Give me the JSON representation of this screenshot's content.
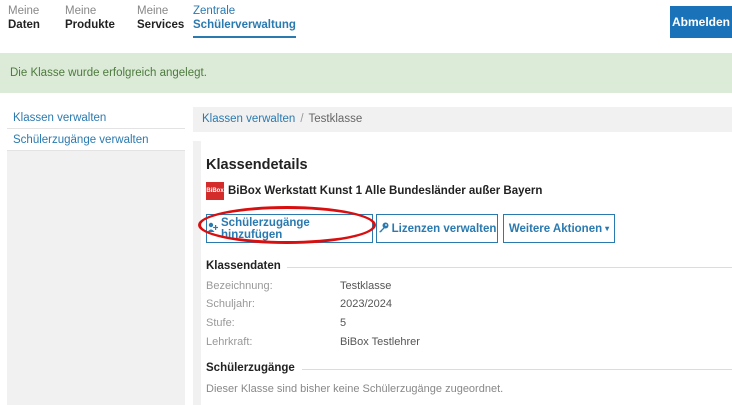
{
  "nav": {
    "items": [
      {
        "line1": "Meine",
        "line2": "Daten"
      },
      {
        "line1": "Meine",
        "line2": "Produkte"
      },
      {
        "line1": "Meine",
        "line2": "Services"
      },
      {
        "line1": "Zentrale",
        "line2": "Schülerverwaltung"
      }
    ],
    "logout_label": "Abmelden"
  },
  "alert": {
    "text": "Die Klasse wurde erfolgreich angelegt."
  },
  "sidebar": {
    "items": [
      {
        "label": "Klassen verwalten"
      },
      {
        "label": "Schülerzugänge verwalten"
      }
    ]
  },
  "breadcrumb": {
    "parent": "Klassen verwalten",
    "separator": "/",
    "current": "Testklasse"
  },
  "details": {
    "title": "Klassendetails",
    "product_logo": "BiBox",
    "product_name": "BiBox Werkstatt Kunst 1 Alle Bundesländer außer Bayern"
  },
  "actions": {
    "add_students": "Schülerzugänge hinzufügen",
    "manage_licenses": "Lizenzen verwalten",
    "more_actions": "Weitere Aktionen"
  },
  "class_data": {
    "heading": "Klassendaten",
    "rows": [
      {
        "label": "Bezeichnung:",
        "value": "Testklasse"
      },
      {
        "label": "Schuljahr:",
        "value": "2023/2024"
      },
      {
        "label": "Stufe:",
        "value": "5"
      },
      {
        "label": "Lehrkraft:",
        "value": "BiBox Testlehrer"
      }
    ]
  },
  "student_access": {
    "heading": "Schülerzugänge",
    "empty_text": "Dieser Klasse sind bisher keine Schülerzugänge zugeordnet."
  },
  "colors": {
    "primary": "#2a7ab0",
    "logout_bg": "#1a73b8",
    "alert_bg": "#dcebd7",
    "highlight": "#d90f0f"
  }
}
